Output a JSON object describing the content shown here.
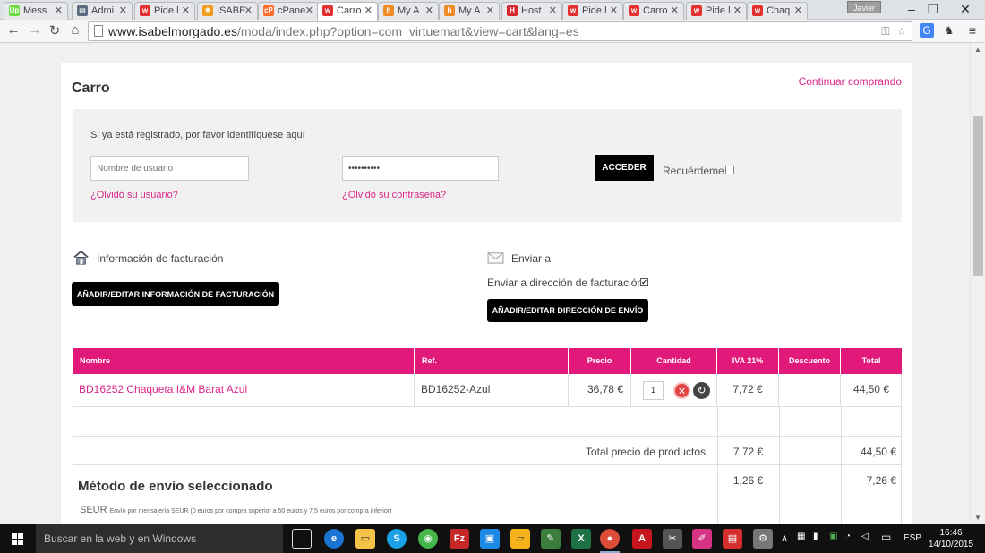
{
  "browser": {
    "tabs": [
      {
        "label": "Mess",
        "icon": "upwork-icon",
        "color": "#6fda44"
      },
      {
        "label": "Admi",
        "icon": "admin-icon",
        "color": "#5b6b80"
      },
      {
        "label": "Pide l",
        "icon": "w-icon",
        "color": "#e53030"
      },
      {
        "label": "ISABE",
        "icon": "joomla-icon",
        "color": "#f29b1d"
      },
      {
        "label": "cPane",
        "icon": "cpanel-icon",
        "color": "#ff6c2c"
      },
      {
        "label": "Carro",
        "icon": "w-icon",
        "color": "#e53030",
        "active": true
      },
      {
        "label": "My A",
        "icon": "hosting-icon",
        "color": "#f08a24"
      },
      {
        "label": "My A",
        "icon": "hosting-icon",
        "color": "#f08a24"
      },
      {
        "label": "Host",
        "icon": "h-icon",
        "color": "#d8262f"
      },
      {
        "label": "Pide l",
        "icon": "w-icon",
        "color": "#e53030"
      },
      {
        "label": "Carro",
        "icon": "w-icon",
        "color": "#e53030"
      },
      {
        "label": "Pide l",
        "icon": "w-icon",
        "color": "#e53030"
      },
      {
        "label": "Chaq",
        "icon": "w-icon",
        "color": "#e53030"
      }
    ],
    "user_name": "Javier",
    "url_host": "www.isabelmorgado.es",
    "url_rest": "/moda/index.php?option=com_virtuemart&view=cart&lang=es"
  },
  "page": {
    "title": "Carro",
    "continue_link": "Continuar comprando",
    "login": {
      "prompt": "Si ya está registrado, por favor identifíquese aquí",
      "username_placeholder": "Nombre de usuario",
      "password_value": "••••••••••",
      "submit": "ACCEDER",
      "remember": "Recuérdeme",
      "forgot_user": "¿Olvidó su usuario?",
      "forgot_password": "¿Olvidó su contraseña?"
    },
    "billing": {
      "title": "Información de facturación",
      "button": "AÑADIR/EDITAR INFORMACIÓN DE FACTURACIÓN"
    },
    "shipping": {
      "title": "Enviar a",
      "same_as_billing": "Enviar a dirección de facturación",
      "same_as_billing_checked": true,
      "button": "AÑADIR/EDITAR DIRECCIÓN DE ENVÍO"
    },
    "table": {
      "headers": [
        "Nombre",
        "Ref.",
        "Precio",
        "Cantidad",
        "IVA 21%",
        "Descuento",
        "Total"
      ],
      "product": {
        "name": "BD16252 Chaqueta I&M Barat Azul",
        "ref": "BD16252-Azul",
        "price": "36,78 €",
        "quantity": "1",
        "tax": "7,72 €",
        "discount": "",
        "total": "44,50 €"
      },
      "subtotal_label": "Total precio de productos",
      "subtotal_tax": "7,72 €",
      "subtotal_total": "44,50 €",
      "shipping_title": "Método de envío seleccionado",
      "shipping_carrier": "SEUR",
      "shipping_desc": "Envío por mensajería SEUR (0 euros por compra superior a 50 euros y 7,5 euros por compra inferior)",
      "shipping_tax": "1,26 €",
      "shipping_total": "7,26 €"
    }
  },
  "taskbar": {
    "search_placeholder": "Buscar en la web y en Windows",
    "language": "ESP",
    "time": "16:46",
    "date": "14/10/2015"
  },
  "colors": {
    "accent": "#e0197a",
    "link": "#d9278a"
  }
}
